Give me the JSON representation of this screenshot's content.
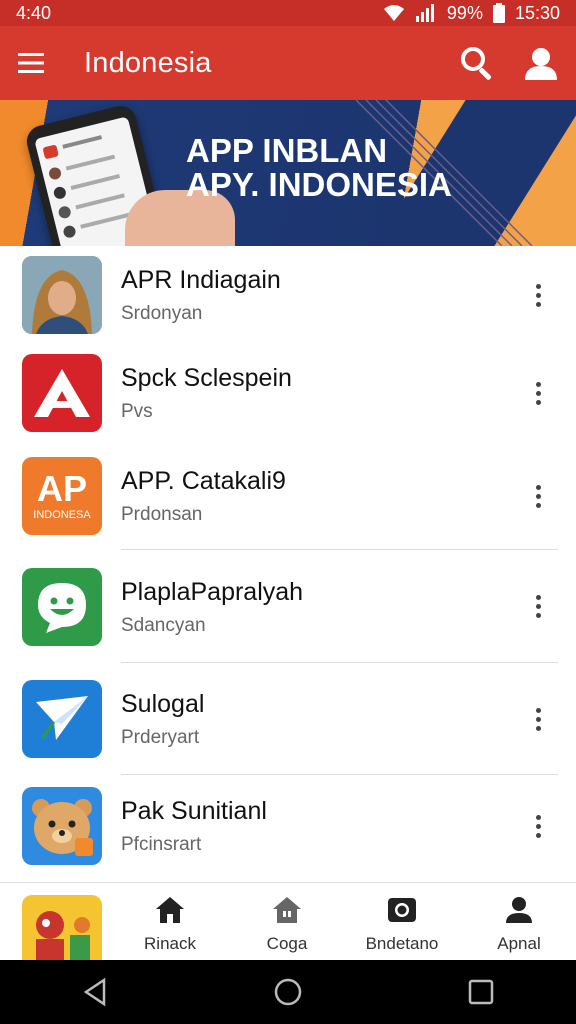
{
  "status_bar": {
    "time_left": "4:40",
    "battery": "99%",
    "time_right": "15:30"
  },
  "app_bar": {
    "title": "Indonesia",
    "icons": [
      "menu-icon",
      "search-icon",
      "account-icon"
    ]
  },
  "banner": {
    "line1": "APP INBLAN",
    "line2": "APY. INDONESIA"
  },
  "apps": [
    {
      "name": "APR Indiagain",
      "sub": "Srdonyan",
      "icon": "person-photo-icon"
    },
    {
      "name": "Spck Sclespein",
      "sub": "Pvs",
      "icon": "red-a-logo-icon"
    },
    {
      "name": "APP. Catakali9",
      "sub": "Prdonsan",
      "icon": "ap-indonesia-logo-icon",
      "logo_text": "AP",
      "logo_sub": "INDONESA"
    },
    {
      "name": "PlaplaPapralyah",
      "sub": "Sdancyan",
      "icon": "green-face-logo-icon"
    },
    {
      "name": "Sulogal",
      "sub": "Prderyart",
      "icon": "blue-arrow-logo-icon"
    },
    {
      "name": "Pak Sunitianl",
      "sub": "Pfcinsrart",
      "icon": "bear-logo-icon"
    }
  ],
  "bottom_nav": [
    {
      "label": "Rinack",
      "icon": "home-icon"
    },
    {
      "label": "Coga",
      "icon": "house-icon"
    },
    {
      "label": "Bndetano",
      "icon": "camera-icon"
    },
    {
      "label": "Apnal",
      "icon": "person-icon"
    }
  ],
  "colors": {
    "status_bar": "#c62f28",
    "app_bar": "#d63a2f",
    "banner_navy": "#1c356f",
    "banner_orange": "#f08a2c"
  }
}
